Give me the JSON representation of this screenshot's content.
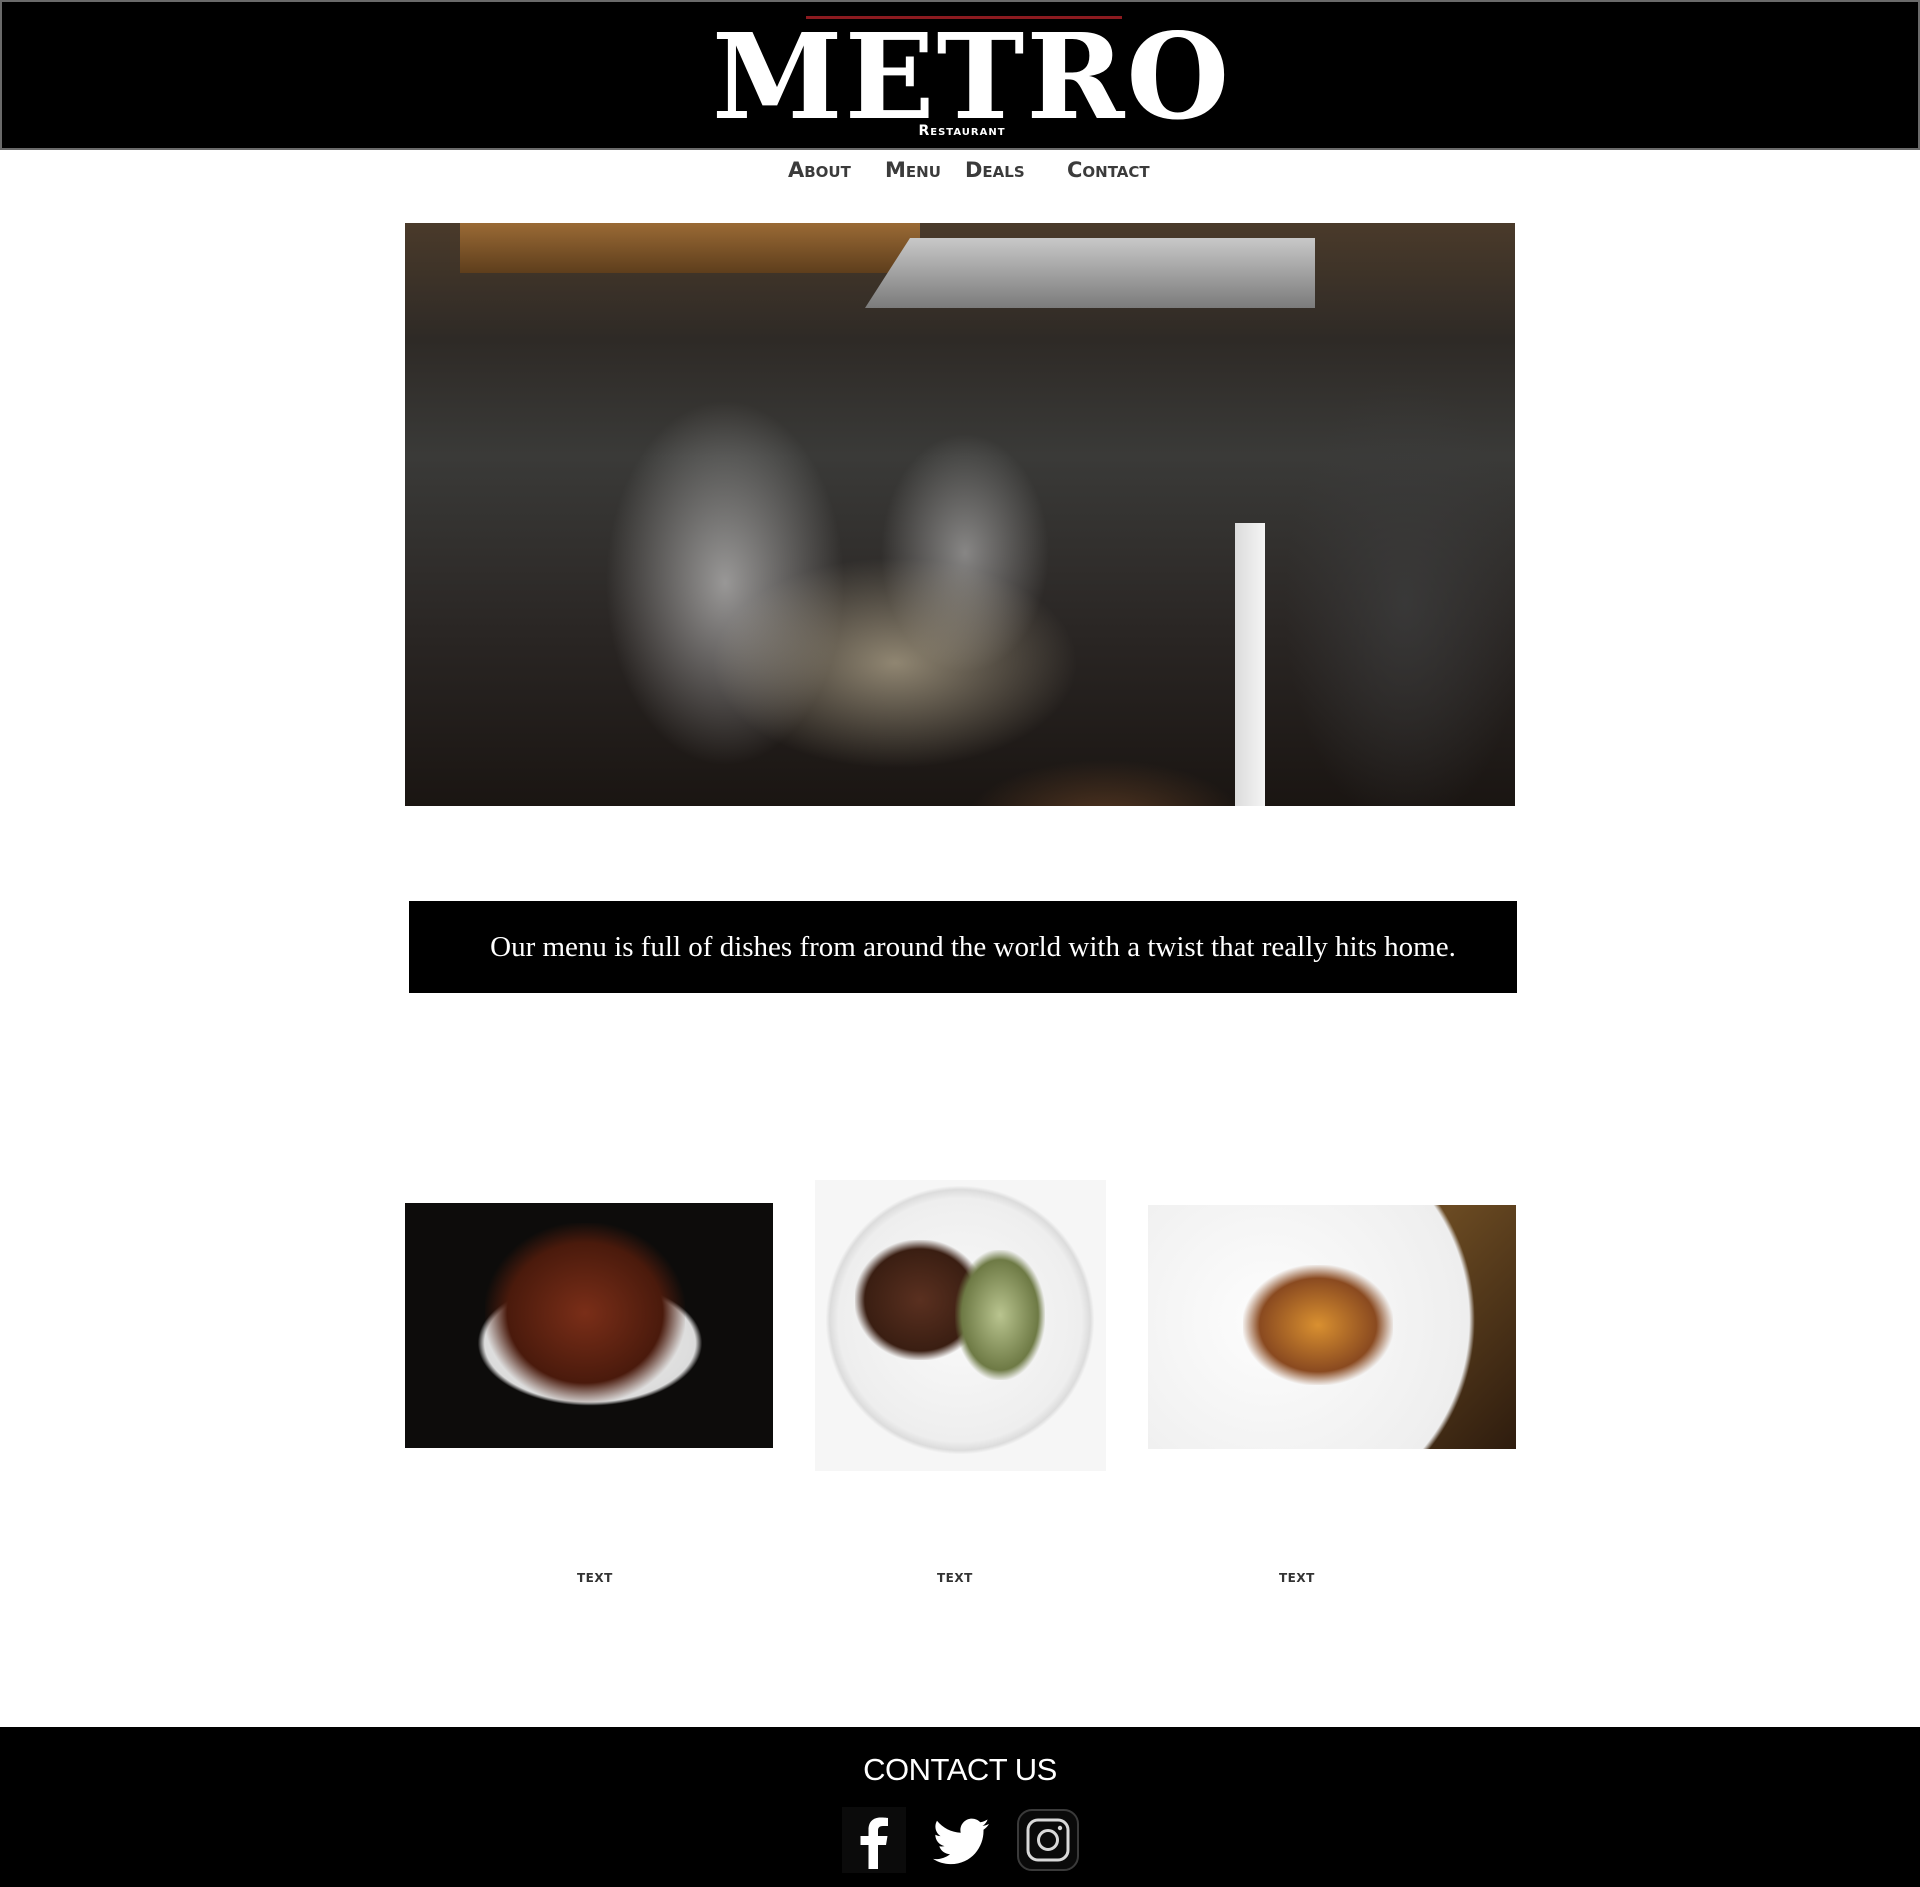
{
  "header": {
    "logo_word": "METRO",
    "logo_sub": "Restaurant"
  },
  "nav": {
    "items": [
      {
        "label": "About"
      },
      {
        "label": "Menu"
      },
      {
        "label": "Deals"
      },
      {
        "label": "Contact"
      }
    ]
  },
  "tagline": {
    "text": "Our menu is full of dishes from around the world with a twist that really hits home."
  },
  "dishes": [
    {
      "caption": "text"
    },
    {
      "caption": "text"
    },
    {
      "caption": "text"
    }
  ],
  "footer": {
    "title": "CONTACT US",
    "social": [
      {
        "icon": "facebook-icon"
      },
      {
        "icon": "twitter-icon"
      },
      {
        "icon": "instagram-icon"
      }
    ]
  },
  "colors": {
    "header_bg": "#000000",
    "accent_rule": "#8c1a1f",
    "nav_text": "#3b3b3b"
  }
}
